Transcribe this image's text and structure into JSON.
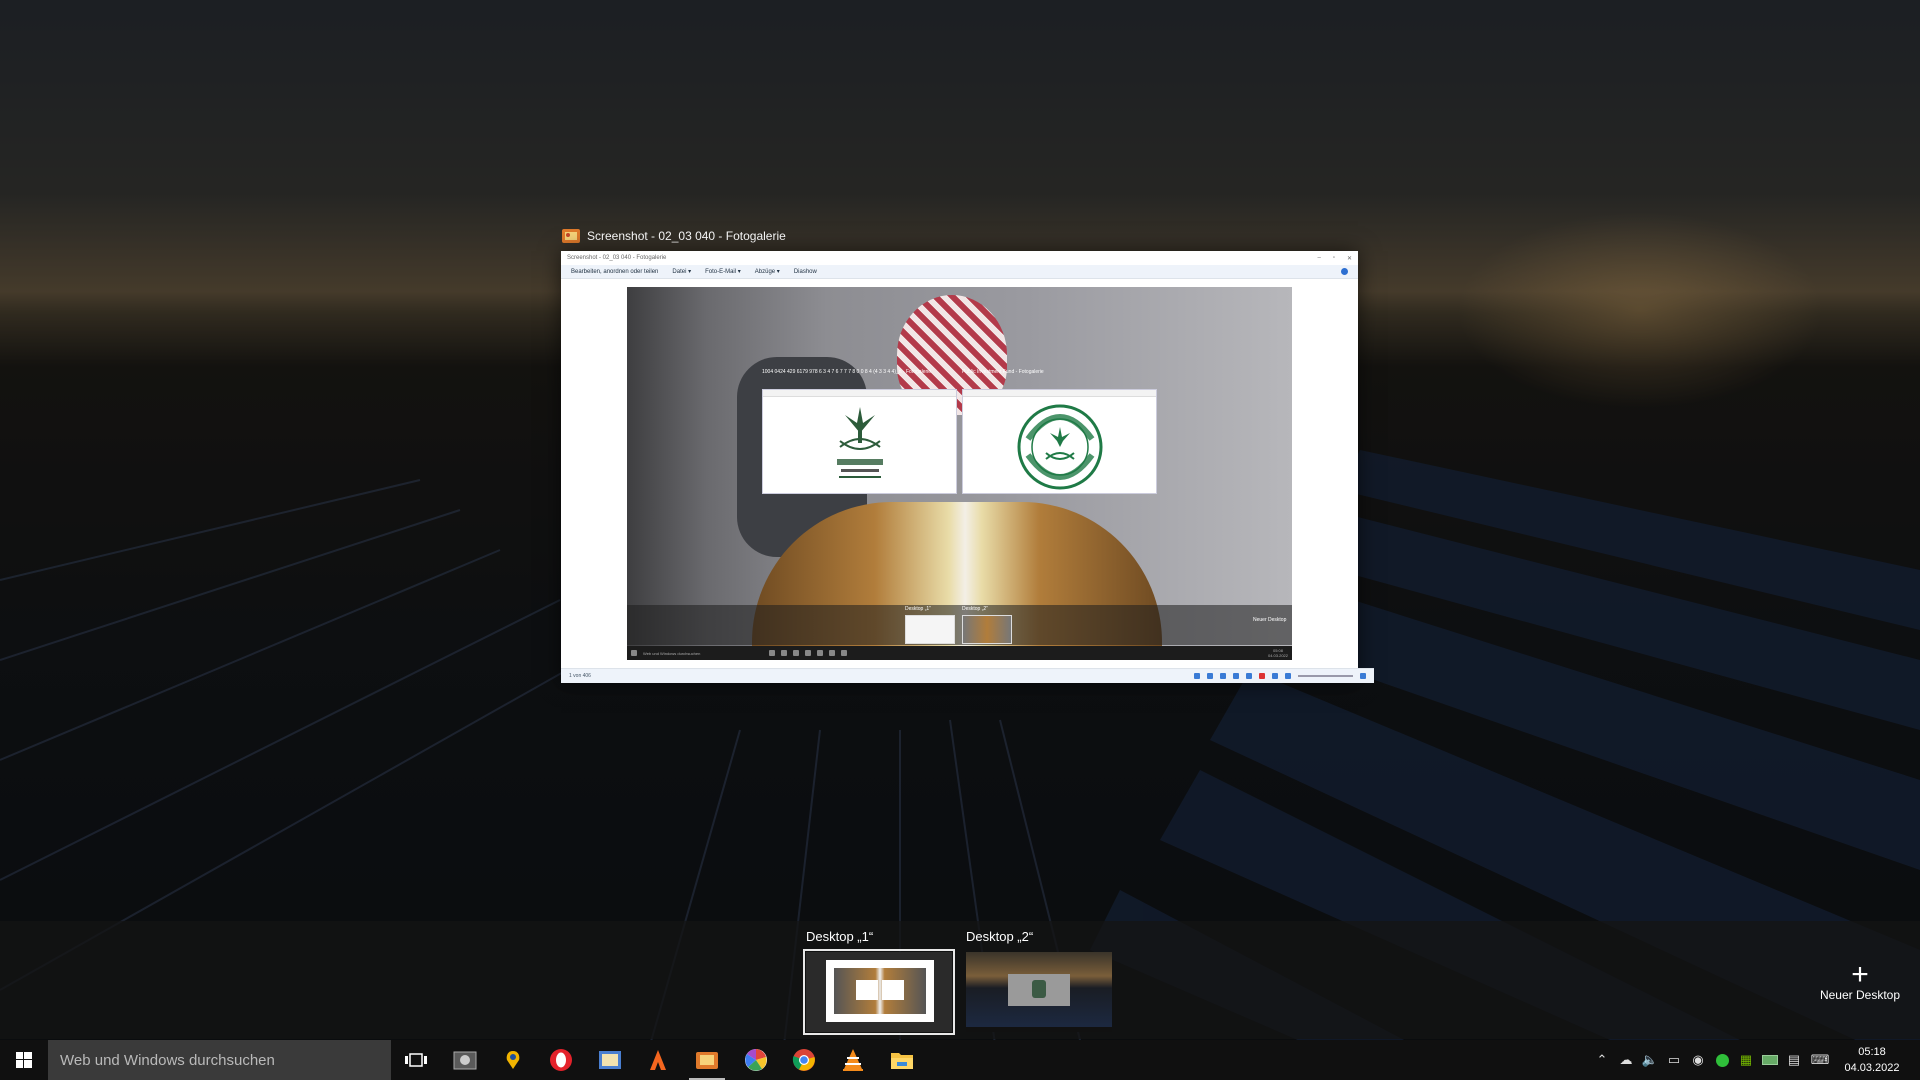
{
  "window": {
    "title": "Screenshot - 02_03 040 - Fotogalerie",
    "inner_title": "Screenshot - 02_03 040 - Fotogalerie",
    "menu": [
      "Bearbeiten, anordnen oder teilen",
      "Datei ▾",
      "Foto-E-Mail ▾",
      "Abzüge ▾",
      "Diashow"
    ],
    "status_text": "1 von 406",
    "mini_labels": {
      "desktop1": "Desktop „1“",
      "desktop2": "Desktop „2“",
      "new_desktop": "Neuer Desktop",
      "search": "Web und Windows durchsuchen",
      "win1_title": "1004 0424 429 6179 978 6 3 4 7 6 7 7 7 8 0 0 8 4 (4 3 3 4 4)_n - Fotogalerie",
      "win2_title": "Public Investment Fund - Fotogalerie",
      "clock_time": "05:08",
      "clock_date": "04.03.2022"
    }
  },
  "task_view": {
    "desktops": [
      {
        "label": "Desktop „1“",
        "active": true
      },
      {
        "label": "Desktop „2“",
        "active": false
      }
    ],
    "new_desktop_label": "Neuer Desktop"
  },
  "taskbar": {
    "search_placeholder": "Web und Windows durchsuchen",
    "apps": [
      "task-view-icon",
      "camera-app-icon",
      "map-pin-icon",
      "opera-icon",
      "photo-editor-icon",
      "adobe-icon",
      "photo-gallery-icon",
      "picasa-icon",
      "chrome-icon",
      "vlc-icon",
      "file-explorer-icon"
    ],
    "tray_icons": [
      "chevron-up-icon",
      "network-icon",
      "volume-icon",
      "printer-icon",
      "security-icon",
      "shield-check-icon",
      "nvidia-icon",
      "battery-icon",
      "action-center-icon",
      "keyboard-icon"
    ],
    "time": "05:18",
    "date": "04.03.2022"
  },
  "colors": {
    "accent": "#3a7bd5",
    "taskbar": "#101010",
    "search_box": "#3a3a3a"
  }
}
